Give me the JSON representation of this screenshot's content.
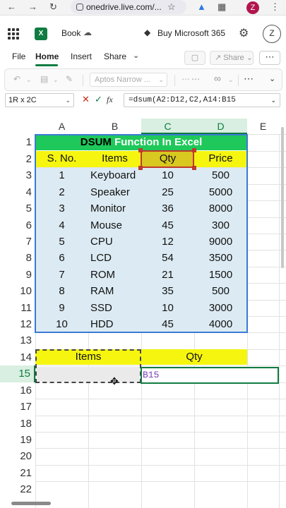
{
  "browser": {
    "url": "onedrive.live.com/...",
    "avatar_letter": "Z",
    "icons": [
      "back-icon",
      "forward-icon",
      "reload-icon",
      "site-settings-icon",
      "star-icon",
      "extension-icon",
      "puzzle-icon",
      "menu-icon"
    ]
  },
  "app": {
    "file_name": "Book",
    "buy_label": "Buy Microsoft 365",
    "user_initial": "Z",
    "brand_color": "#107c41"
  },
  "ribbon": {
    "tabs": [
      {
        "label": "File",
        "active": false
      },
      {
        "label": "Home",
        "active": true
      },
      {
        "label": "Insert",
        "active": false
      },
      {
        "label": "Share",
        "active": false
      }
    ],
    "share_button": "Share",
    "font_name": "Aptos Narrow ..."
  },
  "formula_bar": {
    "name_box": "1R x 2C",
    "formula": "=dsum(A2:D12,C2,A14:B15"
  },
  "grid": {
    "columns": [
      "A",
      "B",
      "C",
      "D",
      "E"
    ],
    "rows": [
      "1",
      "2",
      "3",
      "4",
      "5",
      "6",
      "7",
      "8",
      "9",
      "10",
      "11",
      "12",
      "13",
      "14",
      "15",
      "16",
      "17",
      "18",
      "19",
      "20",
      "21",
      "22"
    ],
    "title_part1": "DSUM",
    "title_part2": " Function In Excel",
    "headers": [
      "S. No.",
      "Items",
      "Qty",
      "Price"
    ],
    "data": [
      [
        "1",
        "Keyboard",
        "10",
        "500"
      ],
      [
        "2",
        "Speaker",
        "25",
        "5000"
      ],
      [
        "3",
        "Monitor",
        "36",
        "8000"
      ],
      [
        "4",
        "Mouse",
        "45",
        "300"
      ],
      [
        "5",
        "CPU",
        "12",
        "9000"
      ],
      [
        "6",
        "LCD",
        "54",
        "3500"
      ],
      [
        "7",
        "ROM",
        "21",
        "1500"
      ],
      [
        "8",
        "RAM",
        "35",
        "500"
      ],
      [
        "9",
        "SSD",
        "10",
        "3000"
      ],
      [
        "10",
        "HDD",
        "45",
        "4000"
      ]
    ],
    "criteria_headers": [
      "Items",
      "Qty"
    ],
    "active_cell_text": "B15",
    "title_color": "#1ec85a",
    "header_color": "#f5f510",
    "data_fill": "#dcebf3"
  }
}
